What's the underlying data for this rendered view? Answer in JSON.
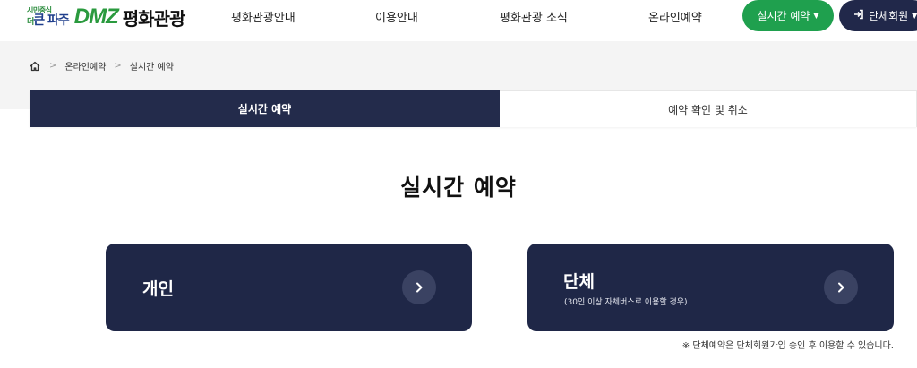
{
  "header": {
    "logo_small_top": "시민중심",
    "logo_small_prefix": "더",
    "logo_small_main": "큰 파주",
    "logo_dmz": "DMZ",
    "logo_main": "평화관광",
    "nav": [
      {
        "label": "평화관광안내"
      },
      {
        "label": "이용안내"
      },
      {
        "label": "평화관광 소식"
      },
      {
        "label": "온라인예약"
      }
    ],
    "reserve_button": "실시간 예약",
    "reserve_caret": "▼",
    "group_login_button": "단체회원",
    "group_caret": "▼"
  },
  "breadcrumb": {
    "items": [
      "온라인예약",
      "실시간 예약"
    ],
    "separator": ">"
  },
  "tabs": [
    {
      "label": "실시간 예약",
      "active": true
    },
    {
      "label": "예약 확인 및 취소",
      "active": false
    }
  ],
  "page_title": "실시간 예약",
  "cards": {
    "individual": {
      "title": "개인"
    },
    "group": {
      "title": "단체",
      "subtitle": "(30인 이상 자체버스로 이용할 경우)"
    }
  },
  "note": "※ 단체예약은 단체회원가입 승인 후 이용할 수 있습니다.",
  "colors": {
    "navy": "#232b4b",
    "green": "#1fa04e",
    "band": "#f4f4f4"
  }
}
